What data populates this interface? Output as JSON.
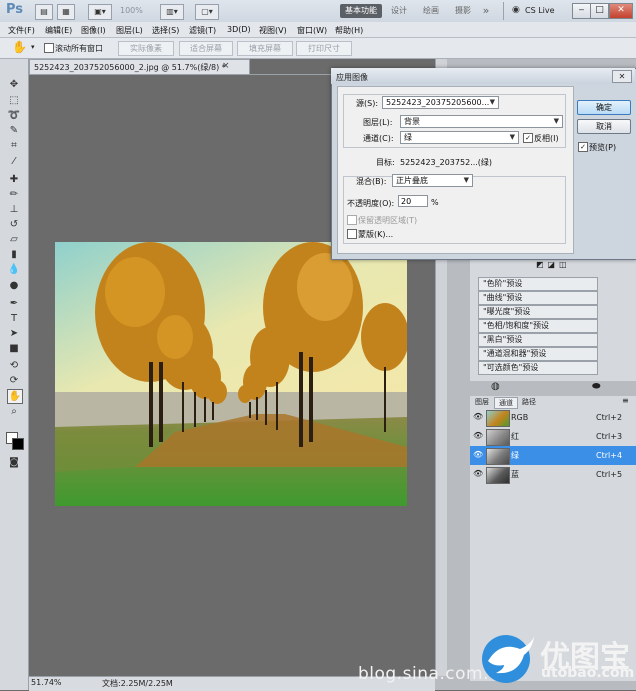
{
  "app": {
    "logo": "Ps",
    "zoom_select": "100%",
    "workspace_active": "基本功能",
    "workspaces": [
      "设计",
      "绘画",
      "摄影"
    ],
    "more": "»",
    "cslive": "CS Live",
    "win_min": "‒",
    "win_max": "□",
    "win_close": "✕"
  },
  "menu": [
    "文件(F)",
    "编辑(E)",
    "图像(I)",
    "图层(L)",
    "选择(S)",
    "滤镜(T)",
    "3D(D)",
    "视图(V)",
    "窗口(W)",
    "帮助(H)"
  ],
  "options": {
    "scroll_all_label": "滚动所有窗口",
    "buttons": [
      "实际像素",
      "适合屏幕",
      "填充屏幕",
      "打印尺寸"
    ]
  },
  "document": {
    "tab_title": "5252423_203752056000_2.jpg @ 51.7%(绿/8) *",
    "tab_close": "×"
  },
  "status": {
    "zoom": "51.74%",
    "doc_info": "文档:2.25M/2.25M"
  },
  "dialog": {
    "title": "应用图像",
    "close": "✕",
    "source_label": "源(S):",
    "source_value": "5252423_20375205600...",
    "layer_label": "图层(L):",
    "layer_value": "背景",
    "channel_label": "通道(C):",
    "channel_value": "绿",
    "invert_label": "反相(I)",
    "target_label": "目标:",
    "target_value": "5252423_203752...(绿)",
    "blend_label": "混合(B):",
    "blend_value": "正片叠底",
    "opacity_label": "不透明度(O):",
    "opacity_value": "20",
    "opacity_unit": "%",
    "preserve_label": "保留透明区域(T)",
    "mask_label": "蒙版(K)...",
    "ok": "确定",
    "cancel": "取消",
    "preview": "预览(P)"
  },
  "adjustments": [
    "\"色阶\"预设",
    "\"曲线\"预设",
    "\"曝光度\"预设",
    "\"色相/饱和度\"预设",
    "\"黑白\"预设",
    "\"通道混和器\"预设",
    "\"可选颜色\"预设"
  ],
  "channels": {
    "tabs": [
      "图层",
      "通道",
      "路径"
    ],
    "rows": [
      {
        "name": "RGB",
        "key": "Ctrl+2"
      },
      {
        "name": "红",
        "key": "Ctrl+3"
      },
      {
        "name": "绿",
        "key": "Ctrl+4"
      },
      {
        "name": "蓝",
        "key": "Ctrl+5"
      }
    ],
    "selected_index": 2
  },
  "watermark": {
    "blog": "blog.sina.com.cn/",
    "brand": "优图宝",
    "url": "utobao.com"
  },
  "colors": {
    "accent": "#3b8fe6",
    "selected_row": "#3b8fe6"
  }
}
